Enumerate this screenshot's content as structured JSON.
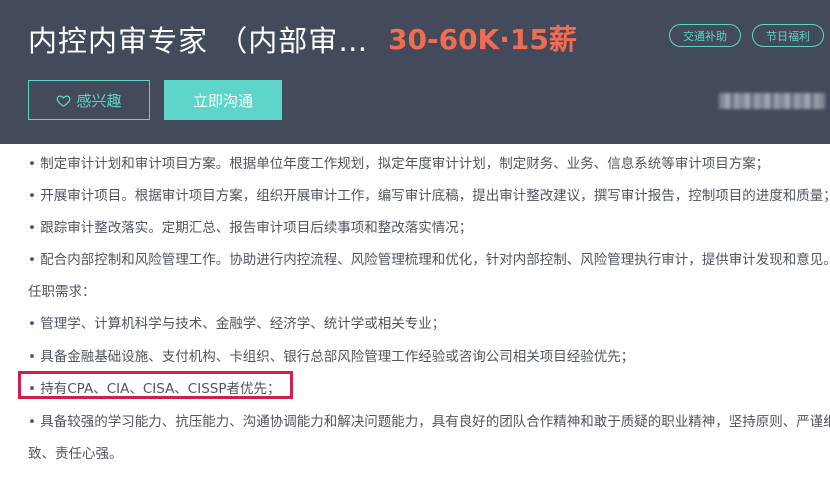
{
  "header": {
    "job_title": "内控内审专家 （内部审…",
    "salary": "30-60K·15薪",
    "tags": [
      "交通补助",
      "节日福利"
    ],
    "interest_button": "感兴趣",
    "chat_button": "立即沟通"
  },
  "content": {
    "lines": [
      "• 制定审计计划和审计项目方案。根据单位年度工作规划，拟定年度审计计划，制定财务、业务、信息系统等审计项目方案；",
      "• 开展审计项目。根据审计项目方案，组织开展审计工作，编写审计底稿，提出审计整改建议，撰写审计报告，控制项目的进度和质量；",
      "• 跟踪审计整改落实。定期汇总、报告审计项目后续事项和整改落实情况；",
      "• 配合内部控制和风险管理工作。协助进行内控流程、风险管理梳理和优化，针对内部控制、风险管理执行审计，提供审计发现和意见。",
      "任职需求：",
      "• 管理学、计算机科学与技术、金融学、经济学、统计学或相关专业；",
      "• 具备金融基础设施、支付机构、卡组织、银行总部风险管理工作经验或咨询公司相关项目经验优先；",
      "• 持有CPA、CIA、CISA、CISSP者优先；",
      "• 具备较强的学习能力、抗压能力、沟通协调能力和解决问题能力，具有良好的团队合作精神和敢于质疑的职业精神，坚持原则、严谨细",
      "致、责任心强。"
    ]
  }
}
